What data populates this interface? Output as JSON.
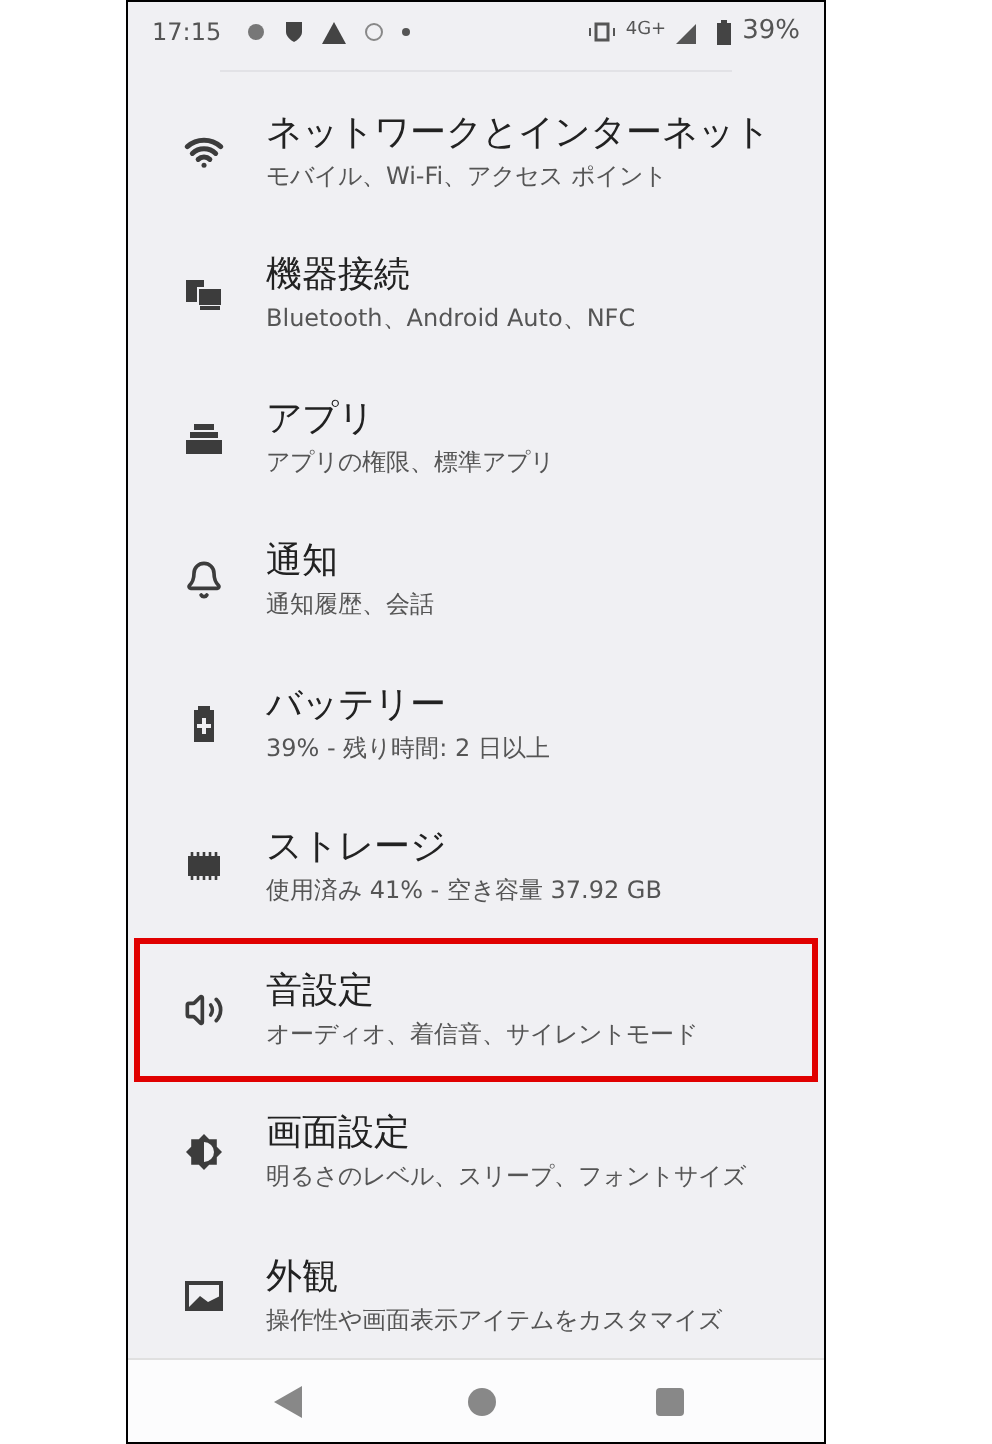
{
  "status_bar": {
    "time": "17:15",
    "network": "4G+",
    "battery": "39%"
  },
  "settings": [
    {
      "kind": "wifi",
      "title": "ネットワークとインターネット",
      "subtitle": "モバイル、Wi-Fi、アクセス ポイント",
      "highlighted": false
    },
    {
      "kind": "devices",
      "title": "機器接続",
      "subtitle": "Bluetooth、Android Auto、NFC",
      "highlighted": false
    },
    {
      "kind": "apps",
      "title": "アプリ",
      "subtitle": "アプリの権限、標準アプリ",
      "highlighted": false
    },
    {
      "kind": "bell",
      "title": "通知",
      "subtitle": "通知履歴、会話",
      "highlighted": false
    },
    {
      "kind": "battery",
      "title": "バッテリー",
      "subtitle": "39% - 残り時間: 2 日以上",
      "highlighted": false
    },
    {
      "kind": "storage",
      "title": "ストレージ",
      "subtitle": "使用済み 41% - 空き容量 37.92 GB",
      "highlighted": false
    },
    {
      "kind": "sound",
      "title": "音設定",
      "subtitle": "オーディオ、着信音、サイレントモード",
      "highlighted": true
    },
    {
      "kind": "display",
      "title": "画面設定",
      "subtitle": "明るさのレベル、スリープ、フォントサイズ",
      "highlighted": false
    },
    {
      "kind": "appearance",
      "title": "外観",
      "subtitle": "操作性や画面表示アイテムをカスタマイズ",
      "highlighted": false
    }
  ]
}
